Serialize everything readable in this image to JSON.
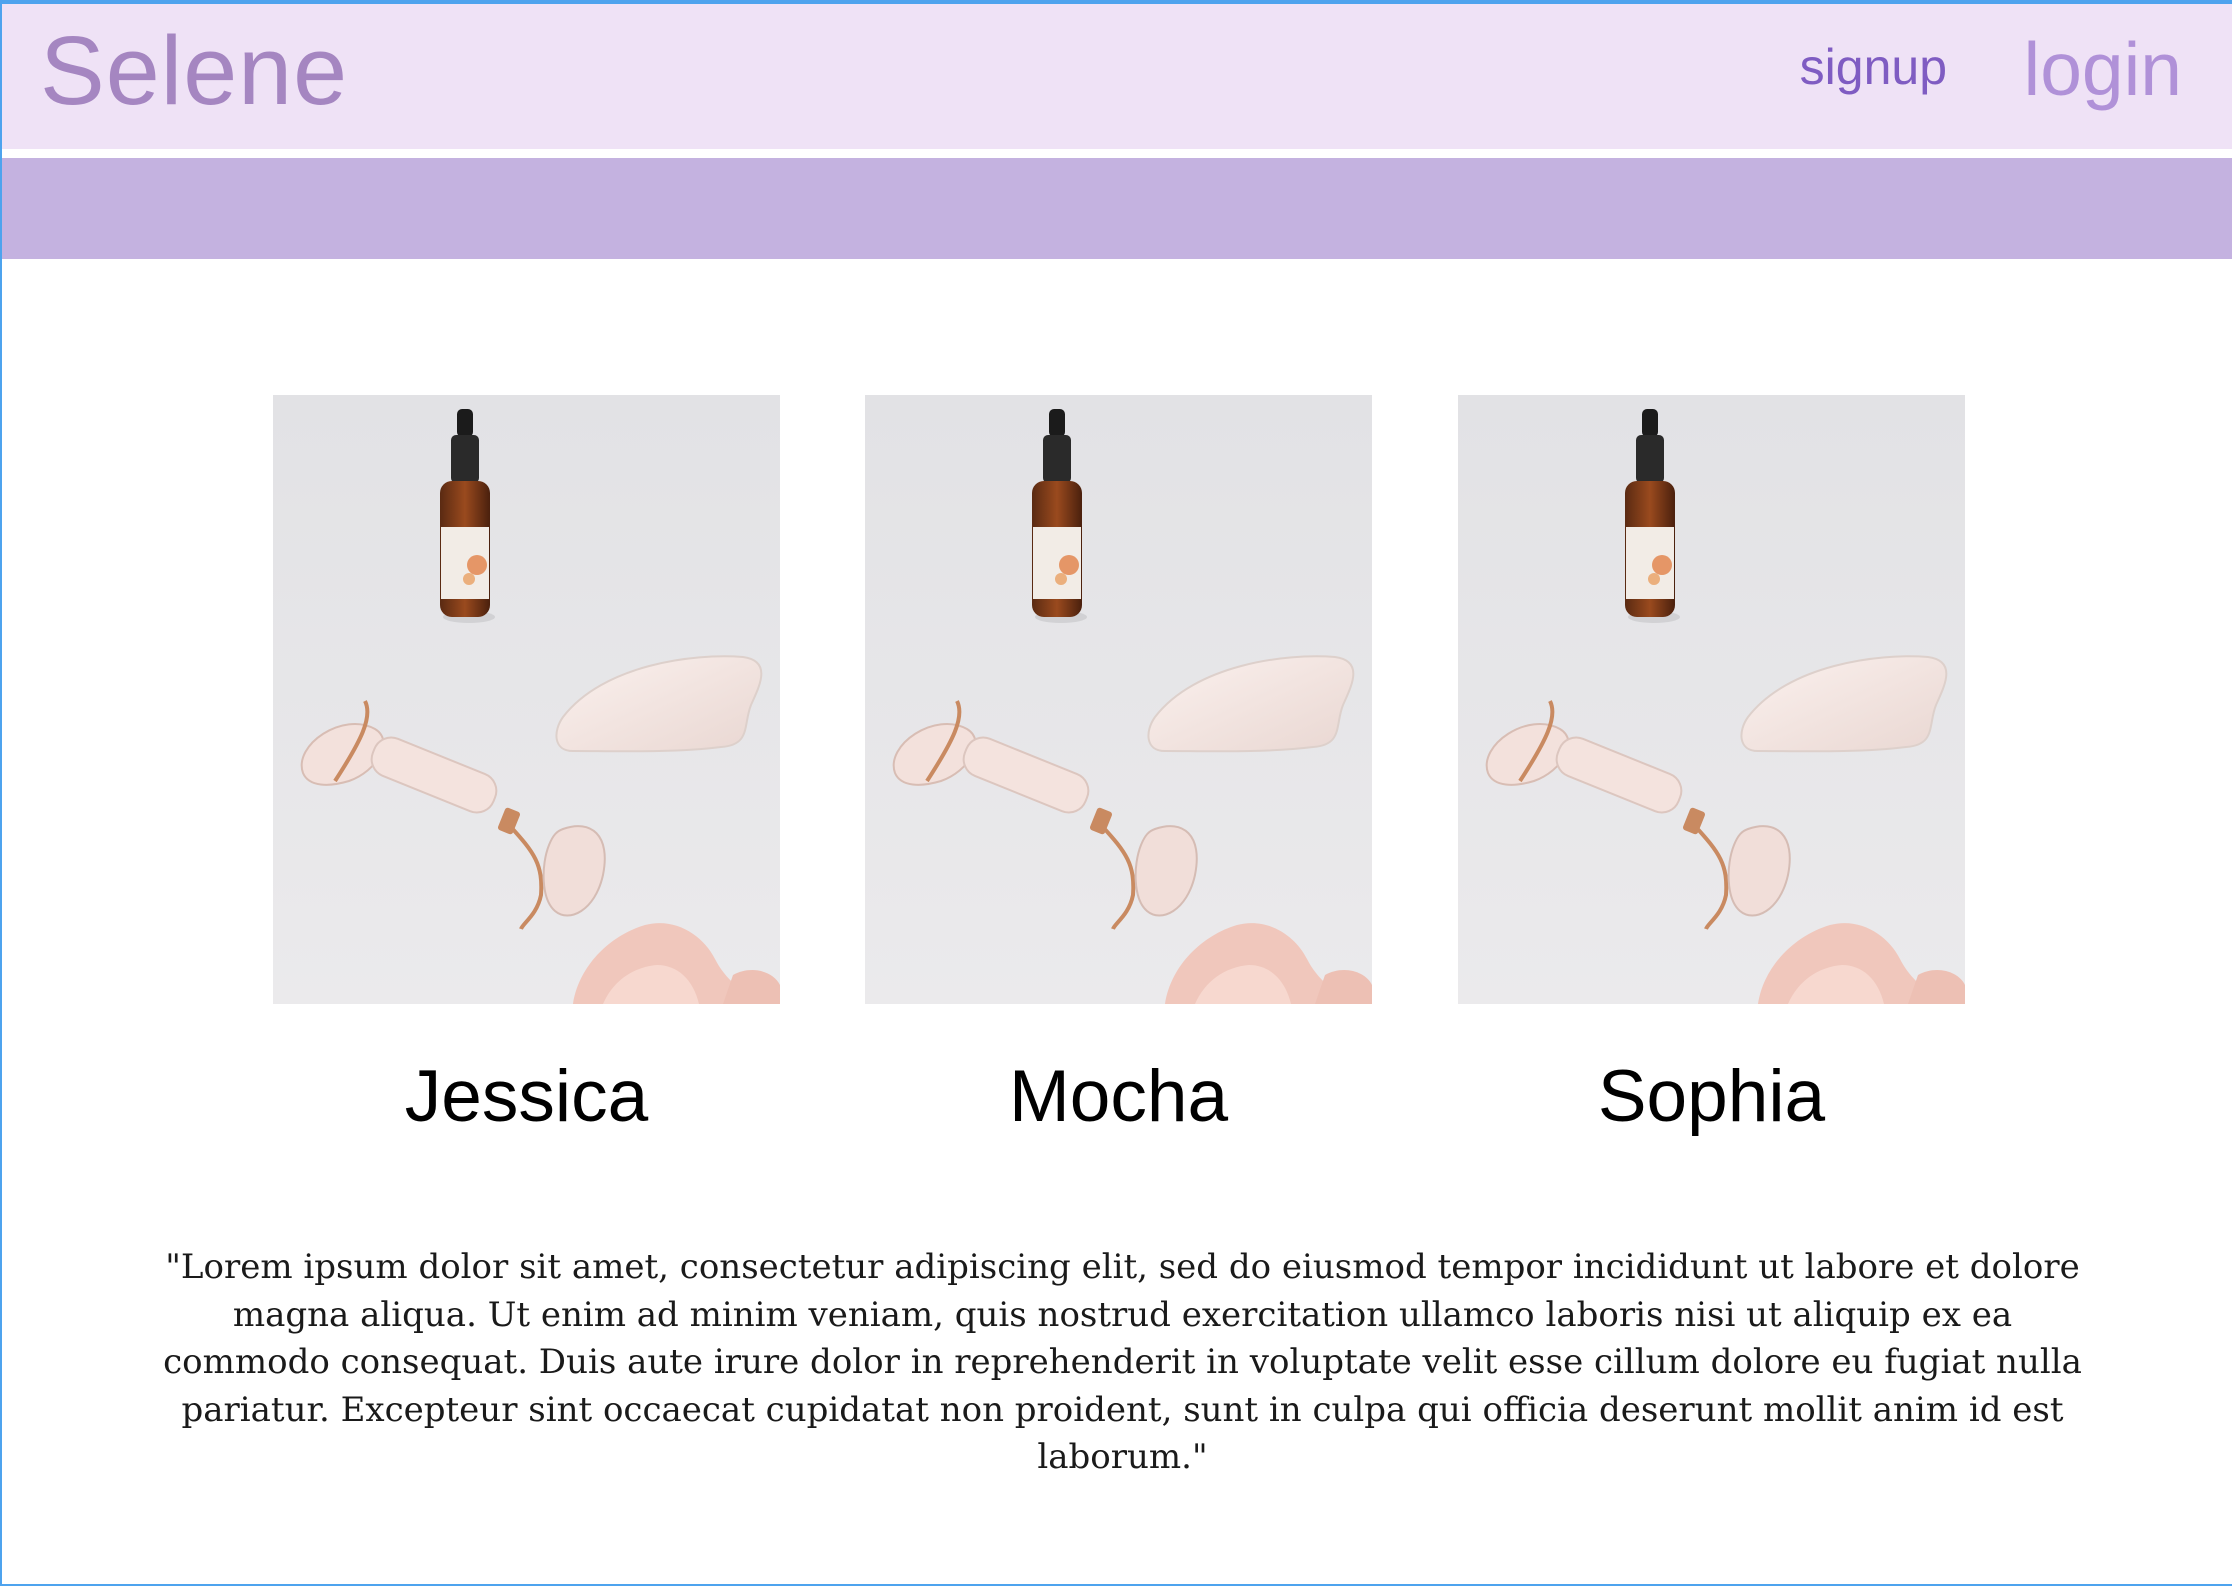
{
  "header": {
    "brand": "Selene",
    "nav": {
      "signup_label": "signup",
      "login_label": "login"
    }
  },
  "colors": {
    "topbar": "#efe2f6",
    "subbar": "#c4b2e0",
    "brand": "#a586c1",
    "signup": "#7f5cc2",
    "login": "#b091d8",
    "frame": "#4ea3ee"
  },
  "profiles": [
    {
      "name": "Jessica",
      "image": "skincare-tools-photo"
    },
    {
      "name": "Mocha",
      "image": "skincare-tools-photo"
    },
    {
      "name": "Sophia",
      "image": "skincare-tools-photo"
    }
  ],
  "quote": "\"Lorem ipsum dolor sit amet, consectetur adipiscing elit, sed do eiusmod tempor incididunt ut labore et dolore magna aliqua. Ut enim ad minim veniam, quis nostrud exercitation ullamco laboris nisi ut aliquip ex ea commodo consequat. Duis aute irure dolor in reprehenderit in voluptate velit esse cillum dolore eu fugiat nulla pariatur. Excepteur sint occaecat cupidatat non proident, sunt in culpa qui officia deserunt mollit anim id est laborum.\""
}
